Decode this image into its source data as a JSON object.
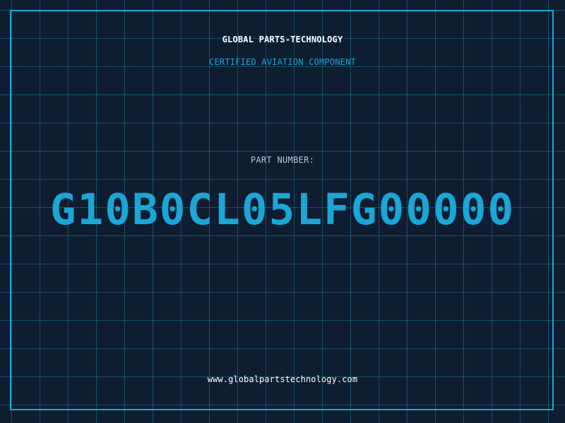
{
  "header": {
    "company": "GLOBAL PARTS-TECHNOLOGY",
    "tagline": "CERTIFIED AVIATION COMPONENT"
  },
  "part": {
    "label": "PART NUMBER:",
    "number": "G10B0CL05LFG00000"
  },
  "footer": {
    "website": "www.globalpartstechnology.com"
  },
  "colors": {
    "background": "#0f1d31",
    "grid": "#207696",
    "accent": "#1aa6d6",
    "text": "#ffffff",
    "muted_text": "#b7c3d1"
  }
}
